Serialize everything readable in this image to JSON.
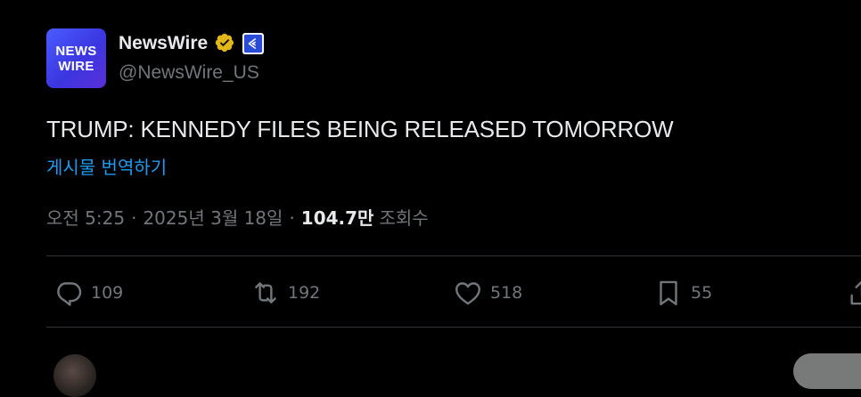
{
  "account": {
    "logo_line1": "NEWS",
    "logo_line2": "WIRE",
    "display_name": "NewsWire",
    "handle": "@NewsWire_US",
    "verified_icon": "gold-verified-badge-icon",
    "affiliation_icon": "affiliate-badge-icon"
  },
  "post": {
    "text": "TRUMP: KENNEDY FILES BEING RELEASED TOMORROW",
    "translate_label": "게시물 번역하기",
    "time": "오전 5:25",
    "separator": "·",
    "date": "2025년 3월 18일",
    "views_count": "104.7만",
    "views_label": "조회수"
  },
  "actions": {
    "reply": {
      "icon": "reply-icon",
      "count": "109"
    },
    "repost": {
      "icon": "repost-icon",
      "count": "192"
    },
    "like": {
      "icon": "heart-icon",
      "count": "518"
    },
    "bookmark": {
      "icon": "bookmark-icon",
      "count": "55"
    },
    "share": {
      "icon": "share-icon"
    }
  },
  "reply_box": {
    "placeholder": ""
  },
  "colors": {
    "background": "#000000",
    "text_primary": "#e7e9ea",
    "text_secondary": "#71767b",
    "link": "#1d9bf0",
    "divider": "#2f3336",
    "verified_gold": "#e2b719"
  }
}
